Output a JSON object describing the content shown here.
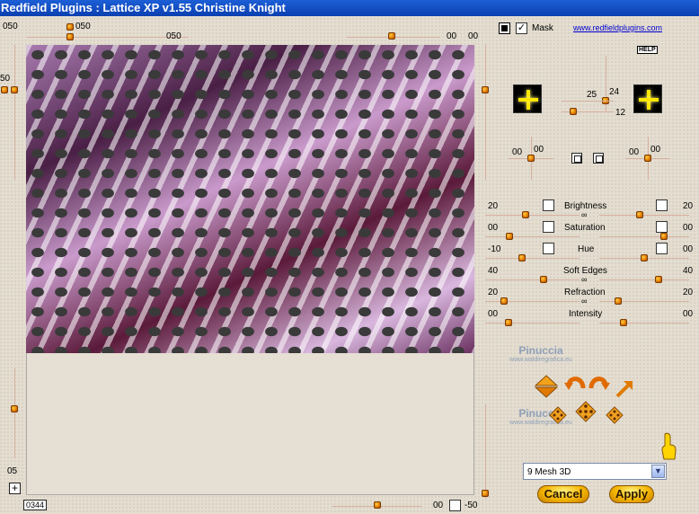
{
  "title": "Redfield Plugins : Lattice XP v1.55   Christine Knight",
  "top": {
    "val_left": "050",
    "knob_label": "050",
    "val_mid": "050",
    "val_r1": "00",
    "val_r2": "00"
  },
  "left": {
    "val_top": "50",
    "val_bottom": "05",
    "counter": "0344"
  },
  "bottom": {
    "val_1": "00",
    "val_2": "-50"
  },
  "mask_label": "Mask",
  "link": "www.redfieldplugins.com",
  "help": "HELP",
  "light": {
    "a": "25",
    "b": "24",
    "c": "12"
  },
  "pos": {
    "a1": "00",
    "a2": "00",
    "b1": "00",
    "b2": "00"
  },
  "adjust": [
    {
      "name": "Brightness",
      "left": "20",
      "right": "20",
      "left_check": true,
      "right_check": true
    },
    {
      "name": "Saturation",
      "left": "00",
      "right": "00",
      "left_check": false,
      "right_check": false
    },
    {
      "name": "Hue",
      "left": "-10",
      "right": "00",
      "left_check": true,
      "right_check": true
    },
    {
      "name": "Soft Edges",
      "left": "40",
      "right": "40",
      "left_check": false,
      "right_check": false
    },
    {
      "name": "Refraction",
      "left": "20",
      "right": "20",
      "left_check": false,
      "right_check": false
    },
    {
      "name": "Intensity",
      "left": "00",
      "right": "00",
      "left_check": false,
      "right_check": false
    }
  ],
  "watermark": {
    "name": "Pinuccia",
    "url": "www.waldiregrafica.eu"
  },
  "preset": {
    "selected": "9 Mesh 3D"
  },
  "buttons": {
    "cancel": "Cancel",
    "apply": "Apply"
  }
}
